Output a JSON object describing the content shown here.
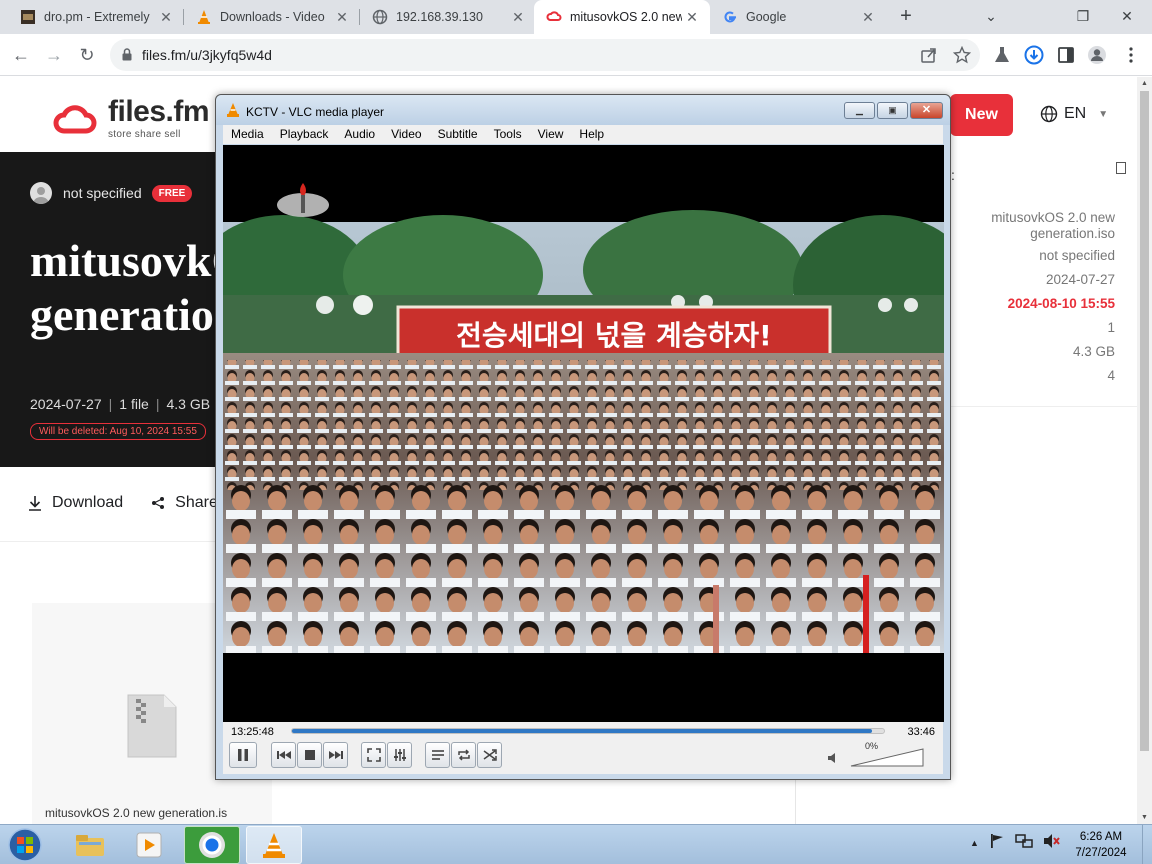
{
  "browser": {
    "tabs": [
      {
        "title": "dro.pm - Extremely",
        "active": false
      },
      {
        "title": "Downloads - Video",
        "active": false
      },
      {
        "title": "192.168.39.130",
        "active": false
      },
      {
        "title": "mitusovkOS 2.0 new",
        "active": true
      },
      {
        "title": "Google",
        "active": false
      }
    ],
    "url": "files.fm/u/3jkyfq5w4d"
  },
  "site": {
    "logo_name": "files.fm",
    "logo_tagline": "store share sell",
    "new_button": "New",
    "language": "EN",
    "owner": "not specified",
    "owner_badge": "FREE",
    "title": "mitusovkOS 2.0 new\ngeneration.iso",
    "meta": {
      "date": "2024-07-27",
      "files": "1 file",
      "size": "4.3 GB"
    },
    "delete_note": "Will be deleted: Aug 10, 2024 15:55",
    "actions": {
      "download": "Download",
      "share": "Share"
    },
    "file_card_name": "mitusovkOS 2.0 new generation.is",
    "panel": {
      "header": ":",
      "name": "mitusovkOS 2.0 new generation.iso",
      "owner": "not specified",
      "created": "2024-07-27",
      "expires": "2024-08-10 15:55",
      "files": "1",
      "size": "4.3 GB",
      "count": "4"
    }
  },
  "vlc": {
    "window_title": "KCTV - VLC media player",
    "menu": [
      "Media",
      "Playback",
      "Audio",
      "Video",
      "Subtitle",
      "Tools",
      "View",
      "Help"
    ],
    "time_elapsed": "13:25:48",
    "time_total": "33:46",
    "progress_fraction": 0.98,
    "volume": "0%",
    "video_banner": "전승세대의 넋을 계승하자!"
  },
  "taskbar": {
    "time": "6:26 AM",
    "date": "7/27/2024"
  },
  "colors": {
    "brand_red": "#e8303a",
    "vlc_progress": "#2f78c5",
    "hero_bg": "#181818"
  }
}
